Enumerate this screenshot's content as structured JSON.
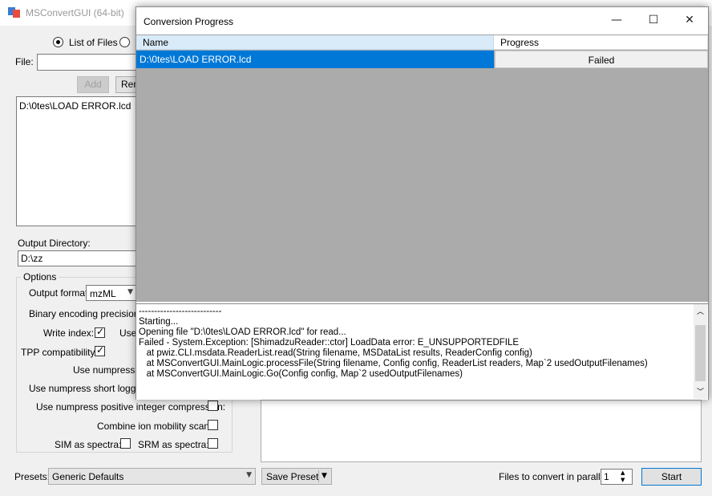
{
  "main": {
    "title": "MSConvertGUI (64-bit)",
    "source_mode": {
      "list_of_files": "List of Files"
    },
    "file_label": "File:",
    "file_value": "",
    "add_label": "Add",
    "remove_label": "Rem",
    "files": [
      "D:\\0tes\\LOAD ERROR.lcd"
    ],
    "output_dir_label": "Output Directory:",
    "output_dir_value": "D:\\zz",
    "options_label": "Options",
    "output_format_label": "Output format:",
    "output_format_value": "mzML",
    "binary_encoding_label": "Binary encoding precision:",
    "write_index_label": "Write index:",
    "write_index_checked": true,
    "use_label": "Use",
    "tpp_label": "TPP compatibility:",
    "tpp_checked": true,
    "numpress_linear_label": "Use numpress lin",
    "numpress_short_label": "Use numpress short logged fl",
    "numpress_positive_label": "Use numpress positive integer compression:",
    "numpress_positive_checked": false,
    "combine_ion_label": "Combine ion mobility scans:",
    "combine_ion_checked": false,
    "sim_label": "SIM as spectra:",
    "sim_checked": false,
    "srm_label": "SRM as spectra:",
    "srm_checked": false,
    "presets_label": "Presets:",
    "presets_value": "Generic Defaults",
    "save_preset_label": "Save Preset",
    "parallel_label": "Files to convert in parallel:",
    "parallel_value": "1",
    "start_label": "Start"
  },
  "dialog": {
    "title": "Conversion Progress",
    "columns": {
      "name": "Name",
      "progress": "Progress"
    },
    "rows": [
      {
        "name": "D:\\0tes\\LOAD ERROR.lcd",
        "progress": "Failed"
      }
    ],
    "log": "---------------------------\nStarting...\nOpening file \"D:\\0tes\\LOAD ERROR.lcd\" for read...\nFailed - System.Exception: [ShimadzuReader::ctor] LoadData error: E_UNSUPPORTEDFILE\n   at pwiz.CLI.msdata.ReaderList.read(String filename, MSDataList results, ReaderConfig config)\n   at MSConvertGUI.MainLogic.processFile(String filename, Config config, ReaderList readers, Map`2 usedOutputFilenames)\n   at MSConvertGUI.MainLogic.Go(Config config, Map`2 usedOutputFilenames)"
  },
  "colors": {
    "selection": "#0078d7",
    "grid_bg": "#ababab",
    "header_selected": "#d9ebf9"
  },
  "icons": [
    "app-icon",
    "minimize-icon",
    "maximize-icon",
    "close-icon",
    "scroll-up-icon",
    "scroll-down-icon",
    "chevron-down-icon"
  ]
}
